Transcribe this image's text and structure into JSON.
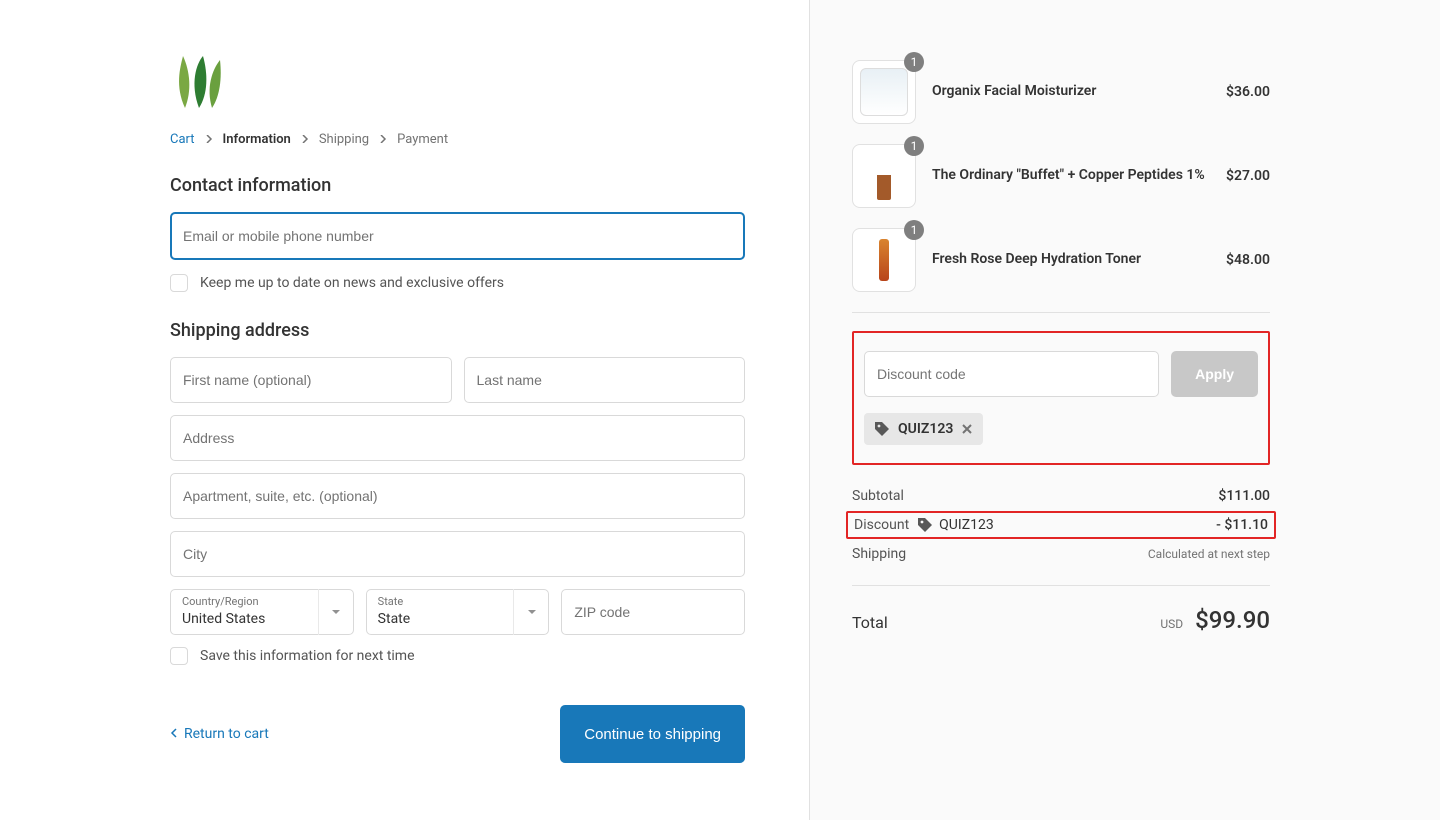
{
  "breadcrumb": {
    "cart": "Cart",
    "information": "Information",
    "shipping": "Shipping",
    "payment": "Payment"
  },
  "contact": {
    "title": "Contact information",
    "email_placeholder": "Email or mobile phone number",
    "news_label": "Keep me up to date on news and exclusive offers"
  },
  "shipping": {
    "title": "Shipping address",
    "first_name": "First name (optional)",
    "last_name": "Last name",
    "address": "Address",
    "apartment": "Apartment, suite, etc. (optional)",
    "city": "City",
    "country_label": "Country/Region",
    "country_value": "United States",
    "state_label": "State",
    "state_value": "State",
    "zip": "ZIP code",
    "save_label": "Save this information for next time"
  },
  "footer": {
    "return": "Return to cart",
    "continue": "Continue to shipping"
  },
  "cart": {
    "items": [
      {
        "name": "Organix Facial Moisturizer",
        "price": "$36.00",
        "qty": "1"
      },
      {
        "name": "The Ordinary \"Buffet\" + Copper Peptides 1%",
        "price": "$27.00",
        "qty": "1"
      },
      {
        "name": "Fresh Rose Deep Hydration Toner",
        "price": "$48.00",
        "qty": "1"
      }
    ],
    "discount_placeholder": "Discount code",
    "apply": "Apply",
    "applied_code": "QUIZ123",
    "subtotal_label": "Subtotal",
    "subtotal_value": "$111.00",
    "discount_label": "Discount",
    "discount_code": "QUIZ123",
    "discount_value": "- $11.10",
    "shipping_label": "Shipping",
    "shipping_value": "Calculated at next step",
    "total_label": "Total",
    "total_currency": "USD",
    "total_value": "$99.90"
  }
}
